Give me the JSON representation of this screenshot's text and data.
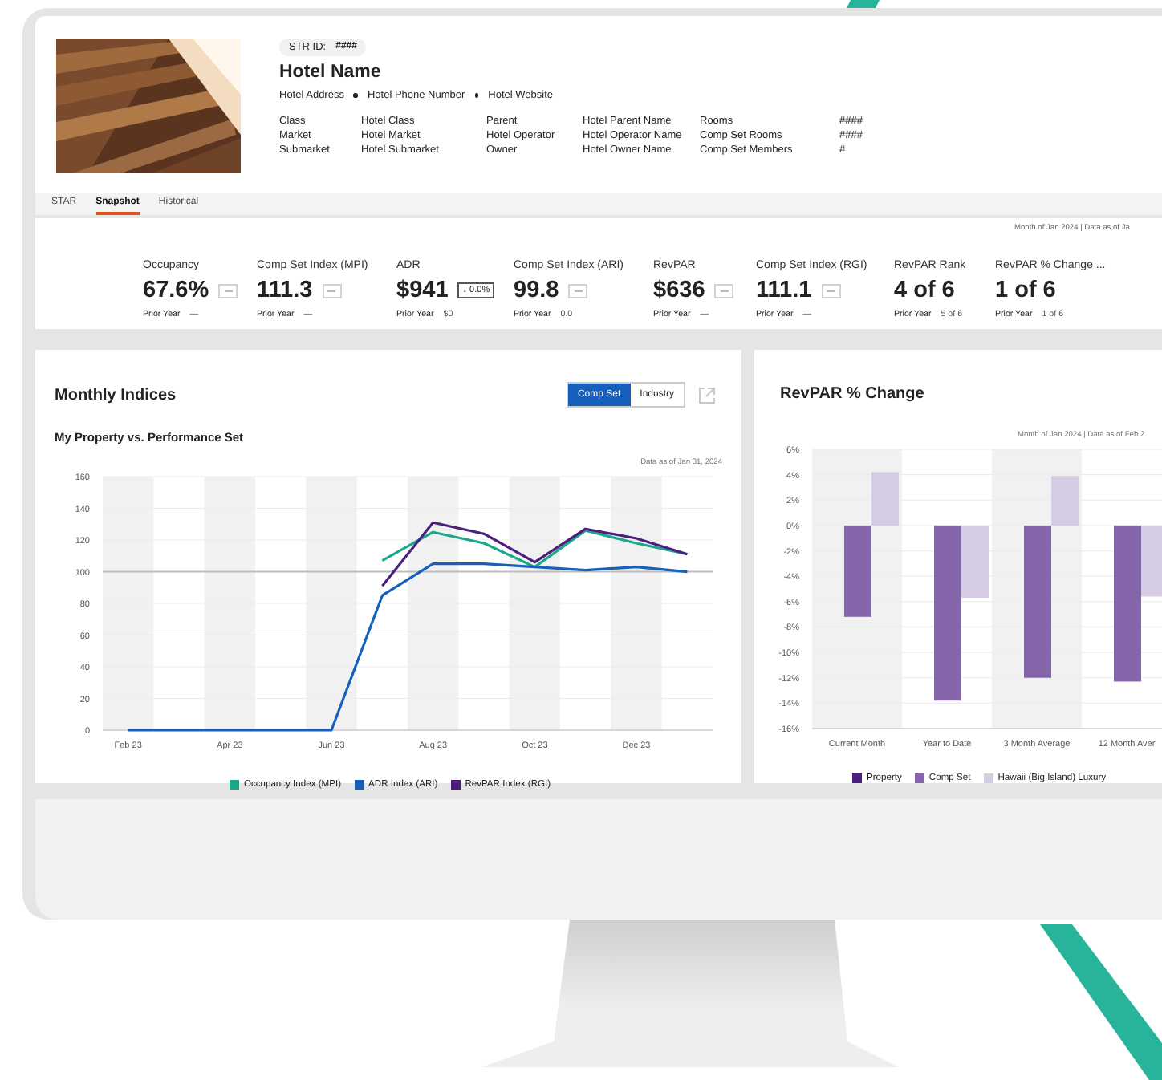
{
  "header": {
    "photo": {
      "kind": "picture"
    },
    "str_id_label": "STR ID:",
    "str_id": "####",
    "hotel_name": "Hotel Name",
    "contact": [
      "Hotel Address",
      "Hotel Phone Number",
      "Hotel Website"
    ],
    "details": [
      [
        {
          "label": "Class",
          "value": "Hotel Class"
        },
        {
          "label": "Parent",
          "value": "Hotel Parent Name"
        },
        {
          "label": "Rooms",
          "value": "####"
        }
      ],
      [
        {
          "label": "Market",
          "value": "Hotel Market"
        },
        {
          "label": "Hotel Operator",
          "value": "Hotel Operator Name"
        },
        {
          "label": "Comp Set Rooms",
          "value": "####"
        }
      ],
      [
        {
          "label": "Submarket",
          "value": "Hotel Submarket"
        },
        {
          "label": "Owner",
          "value": "Hotel Owner Name"
        },
        {
          "label": "Comp Set Members",
          "value": "#"
        }
      ]
    ]
  },
  "tabs": [
    {
      "label": "STAR",
      "selected": false
    },
    {
      "label": "Snapshot",
      "selected": true
    },
    {
      "label": "Historical",
      "selected": false
    }
  ],
  "kpi_panel": {
    "note": "Month of Jan 2024 | Data as of Ja",
    "metrics": [
      {
        "label": "Occupancy",
        "value": "67.6%",
        "badge": {
          "kind": "empty"
        },
        "prior_label": "Prior Year",
        "prior_value": "—"
      },
      {
        "label": "Comp Set Index (MPI)",
        "value": "111.3",
        "badge": {
          "kind": "empty"
        },
        "prior_label": "Prior Year",
        "prior_value": "—"
      },
      {
        "label": "ADR",
        "value": "$941",
        "badge": {
          "kind": "change",
          "text": "↓ 0.0%"
        },
        "prior_label": "Prior Year",
        "prior_value": "$0"
      },
      {
        "label": "Comp Set Index (ARI)",
        "value": "99.8",
        "badge": {
          "kind": "empty"
        },
        "prior_label": "Prior Year",
        "prior_value": "0.0"
      },
      {
        "label": "RevPAR",
        "value": "$636",
        "badge": {
          "kind": "empty"
        },
        "prior_label": "Prior Year",
        "prior_value": "—"
      },
      {
        "label": "Comp Set Index (RGI)",
        "value": "111.1",
        "badge": {
          "kind": "empty"
        },
        "prior_label": "Prior Year",
        "prior_value": "—"
      },
      {
        "label": "RevPAR Rank",
        "value": "4 of 6",
        "prior_label": "Prior Year",
        "prior_value": "5 of 6"
      },
      {
        "label": "RevPAR % Change ...",
        "value": "1 of 6",
        "prior_label": "Prior Year",
        "prior_value": "1 of 6"
      }
    ]
  },
  "monthly_indices": {
    "title": "Monthly Indices",
    "toggle": [
      {
        "label": "Comp Set",
        "selected": true
      },
      {
        "label": "Industry",
        "selected": false
      }
    ],
    "subtitle": "My Property vs. Performance Set",
    "note": "Data as of Jan 31, 2024",
    "chart_data": {
      "type": "line",
      "categories": [
        "Feb 23",
        null,
        "Apr 23",
        null,
        "Jun 23",
        null,
        "Aug 23",
        null,
        "Oct 23",
        null,
        "Dec 23",
        null
      ],
      "ylim": [
        0,
        160
      ],
      "grid": true,
      "yticks": [
        0,
        20,
        40,
        60,
        80,
        100,
        120,
        140,
        160
      ],
      "series": [
        {
          "name": "Occupancy Index (MPI)",
          "color": "#1aa88a",
          "values": [
            null,
            null,
            null,
            null,
            null,
            107,
            125,
            118,
            103,
            126,
            118,
            111
          ]
        },
        {
          "name": "ADR Index (ARI)",
          "color": "#1560bd",
          "values": [
            0,
            0,
            0,
            0,
            0,
            85,
            105,
            105,
            103,
            101,
            103,
            100
          ]
        },
        {
          "name": "RevPAR Index (RGI)",
          "color": "#4b1e80",
          "values": [
            null,
            null,
            null,
            null,
            null,
            91,
            131,
            124,
            106,
            127,
            121,
            111
          ]
        }
      ],
      "ref_lines": [
        {
          "axis": "y",
          "value": 100
        }
      ]
    }
  },
  "revpar_change": {
    "title": "RevPAR % Change",
    "note": "Month of Jan 2024 | Data as of Feb 2",
    "chart_data": {
      "type": "bar",
      "categories": [
        "Current Month",
        "Year to Date",
        "3 Month Average",
        "12 Month Aver"
      ],
      "ylim": [
        -16,
        6
      ],
      "grid": true,
      "yticks": [
        {
          "value": 6,
          "label": "6%"
        },
        {
          "value": 4,
          "label": "4%"
        },
        {
          "value": 2,
          "label": "2%"
        },
        {
          "value": 0,
          "label": "0%"
        },
        {
          "value": -2,
          "label": "-2%"
        },
        {
          "value": -4,
          "label": "-4%"
        },
        {
          "value": -6,
          "label": "-6%"
        },
        {
          "value": -8,
          "label": "-8%"
        },
        {
          "value": -10,
          "label": "-10%"
        },
        {
          "value": -12,
          "label": "-12%"
        },
        {
          "value": -14,
          "label": "-14%"
        },
        {
          "value": -16,
          "label": "-16%"
        }
      ],
      "series": [
        {
          "name": "Property",
          "color": "#4b1e80",
          "values": [
            null,
            null,
            null,
            null
          ]
        },
        {
          "name": "Comp Set",
          "color": "#8566ab",
          "values": [
            -7.2,
            -13.8,
            -12,
            -12.3
          ]
        },
        {
          "name": "Hawaii (Big Island) Luxury",
          "color": "#d5cbe3",
          "values": [
            4.2,
            -5.7,
            3.9,
            -5.6
          ]
        }
      ]
    }
  }
}
